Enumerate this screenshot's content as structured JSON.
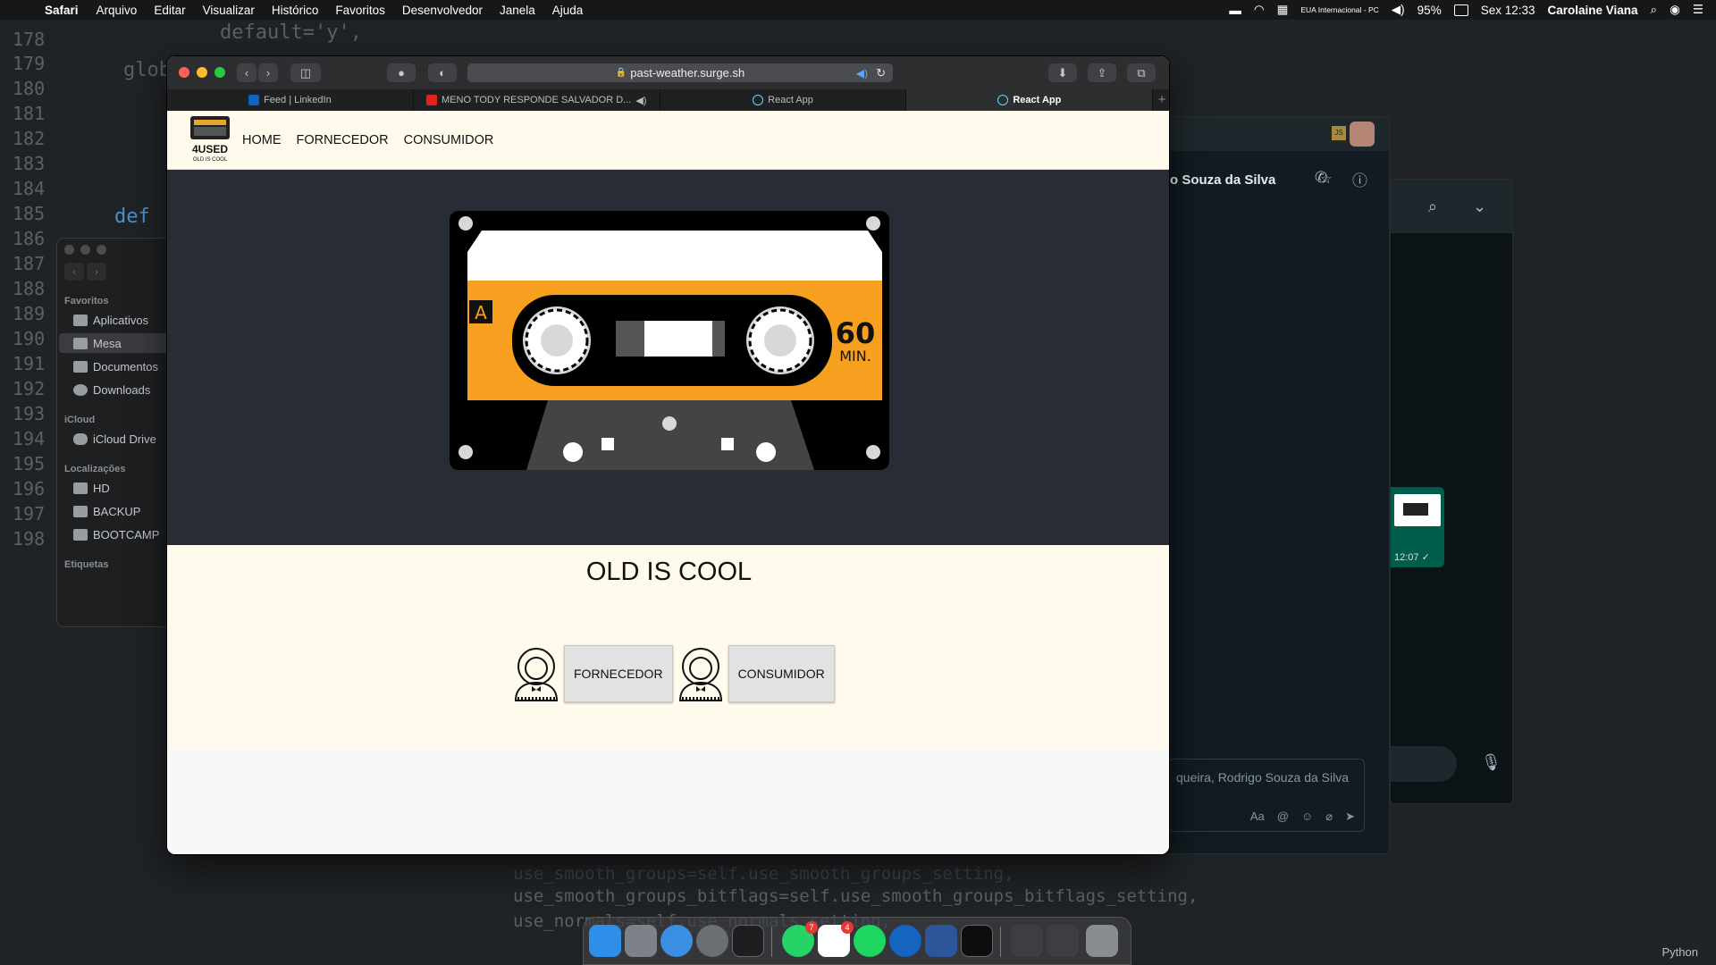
{
  "menubar": {
    "app_name": "Safari",
    "items": [
      "Arquivo",
      "Editar",
      "Visualizar",
      "Histórico",
      "Favoritos",
      "Desenvolvedor",
      "Janela",
      "Ajuda"
    ],
    "keyboard": "EUA Internacional - PC",
    "battery": "95%",
    "clock": "Sex 12:33",
    "user": "Carolaine Viana"
  },
  "code": {
    "line_numbers": [
      "178",
      "179",
      "180",
      "181",
      "182",
      "183",
      "184",
      "185",
      "186",
      "187",
      "188",
      "189",
      "190",
      "191",
      "192",
      "193",
      "194",
      "195",
      "196",
      "197",
      "198"
    ],
    "snippet_default": "default='y',",
    "snippet_glob": "glob",
    "snippet_def": "def",
    "bottom_lines": [
      "use_smooth_groups=self.use_smooth_groups_setting,",
      "use_smooth_groups_bitflags=self.use_smooth_groups_bitflags_setting,",
      "use_normals=self.use_normals_setting,"
    ],
    "status_right": "Python"
  },
  "finder": {
    "section_favoritos": "Favoritos",
    "favoritos": [
      "Aplicativos",
      "Mesa",
      "Documentos",
      "Downloads"
    ],
    "section_icloud": "iCloud",
    "icloud": [
      "iCloud Drive"
    ],
    "section_locais": "Localizações",
    "locais": [
      "HD",
      "BACKUP",
      "BOOTCAMP"
    ],
    "section_etiquetas": "Etiquetas"
  },
  "whatsapp": {
    "contact": "o Souza da Silva",
    "input_placeholder": "queira, Rodrigo Souza da Silva",
    "message_time": "12:07 ✓",
    "initials": "JS"
  },
  "safari": {
    "url": "past-weather.surge.sh",
    "tabs": [
      {
        "label": "Feed | LinkedIn",
        "color": "#0a66c2"
      },
      {
        "label": "MENO TODY RESPONDE SALVADOR D...",
        "color": "#e62117"
      },
      {
        "label": "React App",
        "color": "#61dafb"
      },
      {
        "label": "React App",
        "color": "#61dafb"
      }
    ],
    "active_tab": 3
  },
  "site": {
    "logo_title": "4USED",
    "logo_sub": "OLD IS COOL",
    "nav": [
      "HOME",
      "FORNECEDOR",
      "CONSUMIDOR"
    ],
    "cassette_side": "A",
    "cassette_minutes": "60",
    "cassette_min_label": "MIN.",
    "headline": "OLD IS COOL",
    "buttons": [
      "FORNECEDOR",
      "CONSUMIDOR"
    ],
    "colors": {
      "hero_bg": "#282c34",
      "cream": "#fffaeb",
      "cassette_orange": "#f79f1f"
    }
  },
  "dock": {
    "whatsapp_badge": "7",
    "slack_badge": "4"
  }
}
